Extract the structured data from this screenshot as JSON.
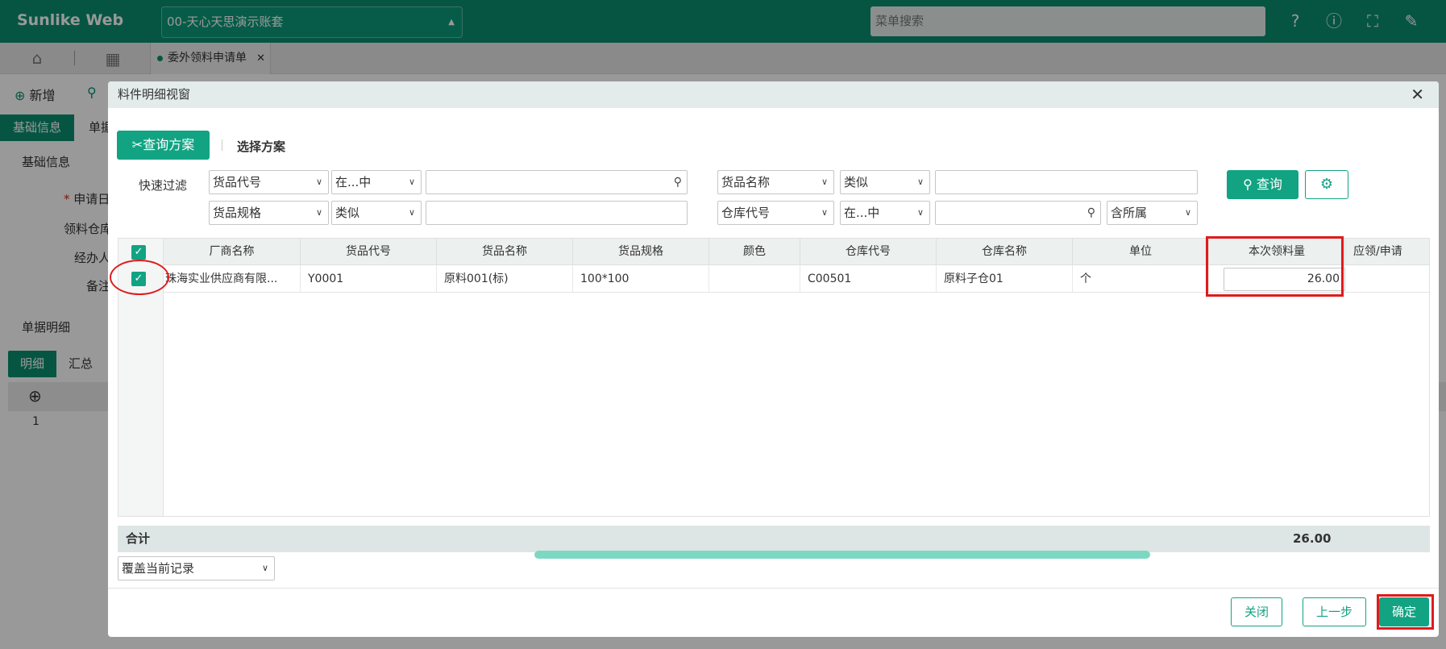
{
  "topbar": {
    "logo": "Sunlike Web",
    "account": "00-天心天思演示账套",
    "menu_search_placeholder": "菜单搜索"
  },
  "tabs": {
    "open_tab": "委外领料申请单"
  },
  "background": {
    "add_label": "新增",
    "tab_basic": "基础信息",
    "tab_doc": "单据",
    "section_basic": "基础信息",
    "field_date": "申请日期",
    "field_warehouse": "领料仓库",
    "field_handler": "经办人",
    "field_note": "备注",
    "section_detail": "单据明细",
    "subtab_detail": "明细",
    "subtab_summary": "汇总",
    "row_number": "1"
  },
  "dialog": {
    "title": "料件明细视窗",
    "query_scheme": "查询方案",
    "select_scheme": "选择方案",
    "quick_filter": "快速过滤",
    "filters": {
      "f1_field": "货品代号",
      "f1_op": "在...中",
      "f1_value": "",
      "f2_field": "货品名称",
      "f2_op": "类似",
      "f2_value": "",
      "f3_field": "货品规格",
      "f3_op": "类似",
      "f3_value": "",
      "f4_field": "仓库代号",
      "f4_op": "在...中",
      "f4_value": "",
      "f4_extra": "含所属"
    },
    "search_label": "查询",
    "columns": [
      "厂商名称",
      "货品代号",
      "货品名称",
      "货品规格",
      "颜色",
      "仓库代号",
      "仓库名称",
      "单位",
      "本次领料量",
      "应领/申请"
    ],
    "rows": [
      {
        "vendor": "珠海实业供应商有限...",
        "code": "Y0001",
        "name": "原料001(标)",
        "spec": "100*100",
        "color": "",
        "wh_code": "C00501",
        "wh_name": "原料子仓01",
        "unit": "个",
        "qty": "26.00"
      }
    ],
    "total_label": "合计",
    "total_qty": "26.00",
    "cover_mode": "覆盖当前记录",
    "close_label": "关闭",
    "prev_label": "上一步",
    "confirm_label": "确定"
  }
}
